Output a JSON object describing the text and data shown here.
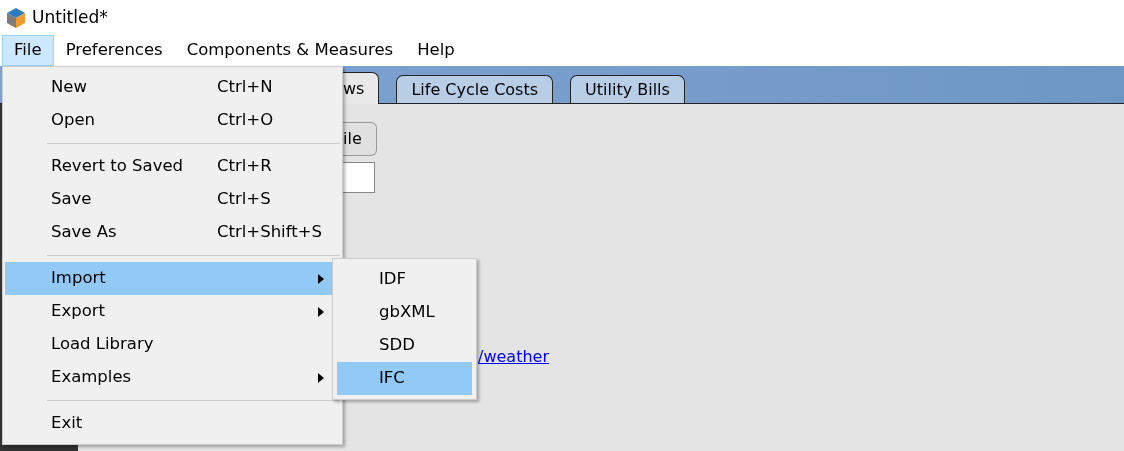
{
  "window": {
    "title": "Untitled*"
  },
  "menubar": [
    {
      "label": "File",
      "selected": true
    },
    {
      "label": "Preferences",
      "selected": false
    },
    {
      "label": "Components & Measures",
      "selected": false
    },
    {
      "label": "Help",
      "selected": false
    }
  ],
  "tabs": [
    {
      "label": "ws",
      "selected": true
    },
    {
      "label": "Life Cycle Costs",
      "selected": false
    },
    {
      "label": "Utility Bills",
      "selected": false
    }
  ],
  "content": {
    "button": "ile",
    "link": "/weather"
  },
  "file_menu": [
    {
      "kind": "item",
      "label": "New",
      "shortcut": "Ctrl+N",
      "submenu": false,
      "selected": false
    },
    {
      "kind": "item",
      "label": "Open",
      "shortcut": "Ctrl+O",
      "submenu": false,
      "selected": false
    },
    {
      "kind": "separator"
    },
    {
      "kind": "item",
      "label": "Revert to Saved",
      "shortcut": "Ctrl+R",
      "submenu": false,
      "selected": false
    },
    {
      "kind": "item",
      "label": "Save",
      "shortcut": "Ctrl+S",
      "submenu": false,
      "selected": false
    },
    {
      "kind": "item",
      "label": "Save As",
      "shortcut": "Ctrl+Shift+S",
      "submenu": false,
      "selected": false
    },
    {
      "kind": "separator"
    },
    {
      "kind": "item",
      "label": "Import",
      "submenu": true,
      "selected": true
    },
    {
      "kind": "item",
      "label": "Export",
      "submenu": true,
      "selected": false
    },
    {
      "kind": "item",
      "label": "Load Library",
      "submenu": false,
      "selected": false
    },
    {
      "kind": "item",
      "label": "Examples",
      "submenu": true,
      "selected": false
    },
    {
      "kind": "separator"
    },
    {
      "kind": "item",
      "label": "Exit",
      "submenu": false,
      "selected": false
    }
  ],
  "import_submenu": [
    {
      "label": "IDF",
      "selected": false
    },
    {
      "label": "gbXML",
      "selected": false
    },
    {
      "label": "SDD",
      "selected": false
    },
    {
      "label": "IFC",
      "selected": true
    }
  ]
}
